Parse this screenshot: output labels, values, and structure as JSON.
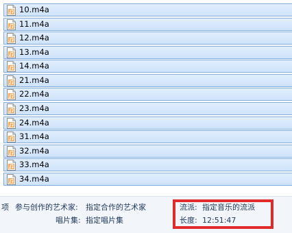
{
  "file_list": {
    "items": [
      {
        "name": "10.m4a"
      },
      {
        "name": "11.m4a"
      },
      {
        "name": "12.m4a"
      },
      {
        "name": "13.m4a"
      },
      {
        "name": "14.m4a"
      },
      {
        "name": "21.m4a"
      },
      {
        "name": "22.m4a"
      },
      {
        "name": "23.m4a"
      },
      {
        "name": "24.m4a"
      },
      {
        "name": "31.m4a"
      },
      {
        "name": "32.m4a"
      },
      {
        "name": "33.m4a"
      },
      {
        "name": "34.m4a"
      }
    ],
    "icon": "audio-file-icon"
  },
  "details_pane": {
    "items_label": "项",
    "contributing_artists_label": "参与创作的艺术家:",
    "contributing_artists_value": "指定合作的艺术家",
    "album_label": "唱片集:",
    "album_value": "指定唱片集",
    "genre_label": "流派:",
    "genre_value": "指定音乐的流派",
    "length_label": "长度:",
    "length_value": "12:51:47"
  },
  "colors": {
    "selected_row_fill": "#cfe3fb",
    "selected_row_border": "#84acdd",
    "details_background": "#f2f5fa",
    "details_text": "#1e395b",
    "highlight_box": "#e12a2a"
  }
}
